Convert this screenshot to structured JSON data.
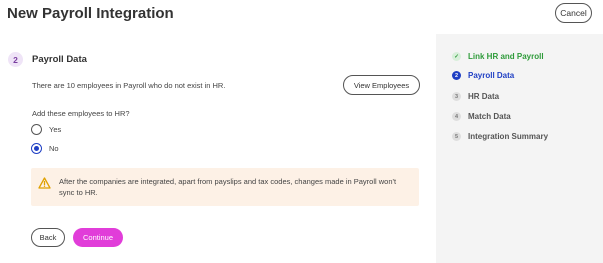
{
  "header": {
    "title": "New Payroll Integration",
    "cancel_label": "Cancel"
  },
  "main": {
    "step_number": "2",
    "section_title": "Payroll Data",
    "info_text": "There are 10 employees in Payroll who do not exist in HR.",
    "view_button_label": "View Employees",
    "question": "Add these employees to HR?",
    "options": [
      {
        "label": "Yes",
        "selected": false
      },
      {
        "label": "No",
        "selected": true
      }
    ],
    "warning": {
      "icon": "warning-icon",
      "text": "After the companies are integrated, apart from payslips and tax codes, changes made in Payroll won't sync to HR."
    },
    "back_label": "Back",
    "continue_label": "Continue"
  },
  "sidebar": {
    "steps": [
      {
        "marker": "✓",
        "label": "Link HR and Payroll",
        "state": "done"
      },
      {
        "marker": "2",
        "label": "Payroll Data",
        "state": "current"
      },
      {
        "marker": "3",
        "label": "HR Data",
        "state": "pending"
      },
      {
        "marker": "4",
        "label": "Match Data",
        "state": "pending"
      },
      {
        "marker": "5",
        "label": "Integration Summary",
        "state": "pending"
      }
    ]
  },
  "colors": {
    "accent_blue": "#1f3fc4",
    "continue_magenta": "#e13dd9",
    "done_green": "#2e9b3a",
    "warning_bg": "#fdf1e6",
    "warning_icon": "#e0a100",
    "sidebar_bg": "#f4f4f4"
  }
}
